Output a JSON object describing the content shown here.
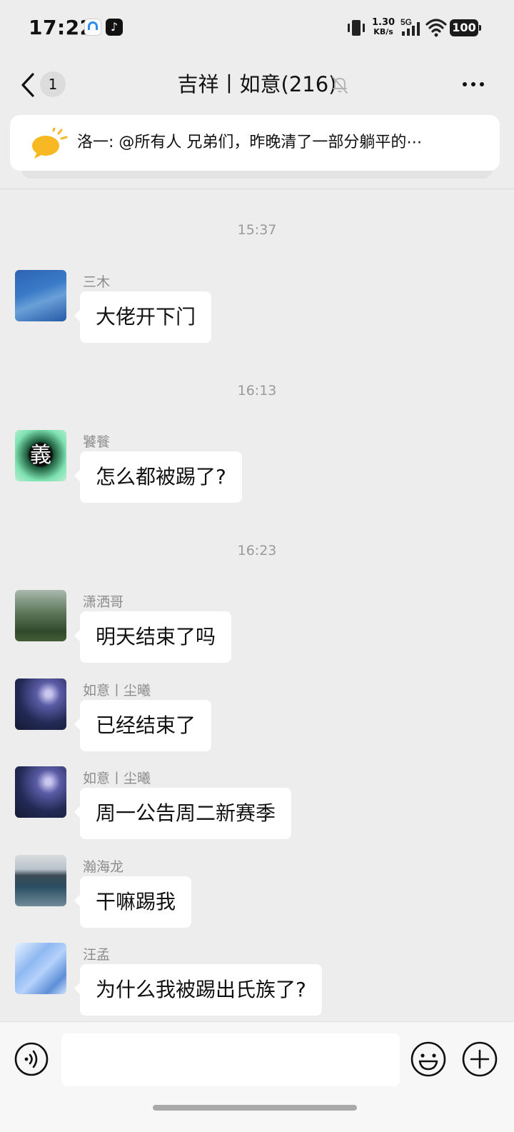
{
  "status_bar": {
    "time": "17:22",
    "speed_value": "1.30",
    "speed_unit": "KB/s",
    "network": "5G",
    "battery": "100"
  },
  "nav": {
    "unread_count": "1",
    "title": "吉祥丨如意(216)",
    "icons": [
      "back-icon",
      "mute-bell-icon",
      "more-icon"
    ]
  },
  "notice": {
    "text": "洛一: @所有人 兄弟们，昨晚清了一部分躺平的⋯",
    "icon": "announcement-icon"
  },
  "timestamps": [
    "15:37",
    "16:13",
    "16:23"
  ],
  "messages": [
    {
      "sender": "三木",
      "text": "大佬开下门"
    },
    {
      "sender": "饕餮",
      "text": "怎么都被踢了?"
    },
    {
      "sender": "潇洒哥",
      "text": "明天结束了吗"
    },
    {
      "sender": "如意丨尘曦",
      "text": "已经结束了"
    },
    {
      "sender": "如意丨尘曦",
      "text": "周一公告周二新赛季"
    },
    {
      "sender": "瀚海龙",
      "text": "干嘛踢我"
    },
    {
      "sender": "汪孟",
      "text": "为什么我被踢出氏族了?"
    }
  ],
  "avatar_badge": "義",
  "input": {
    "placeholder": "",
    "icons": [
      "voice-icon",
      "emoji-icon",
      "plus-icon"
    ]
  }
}
